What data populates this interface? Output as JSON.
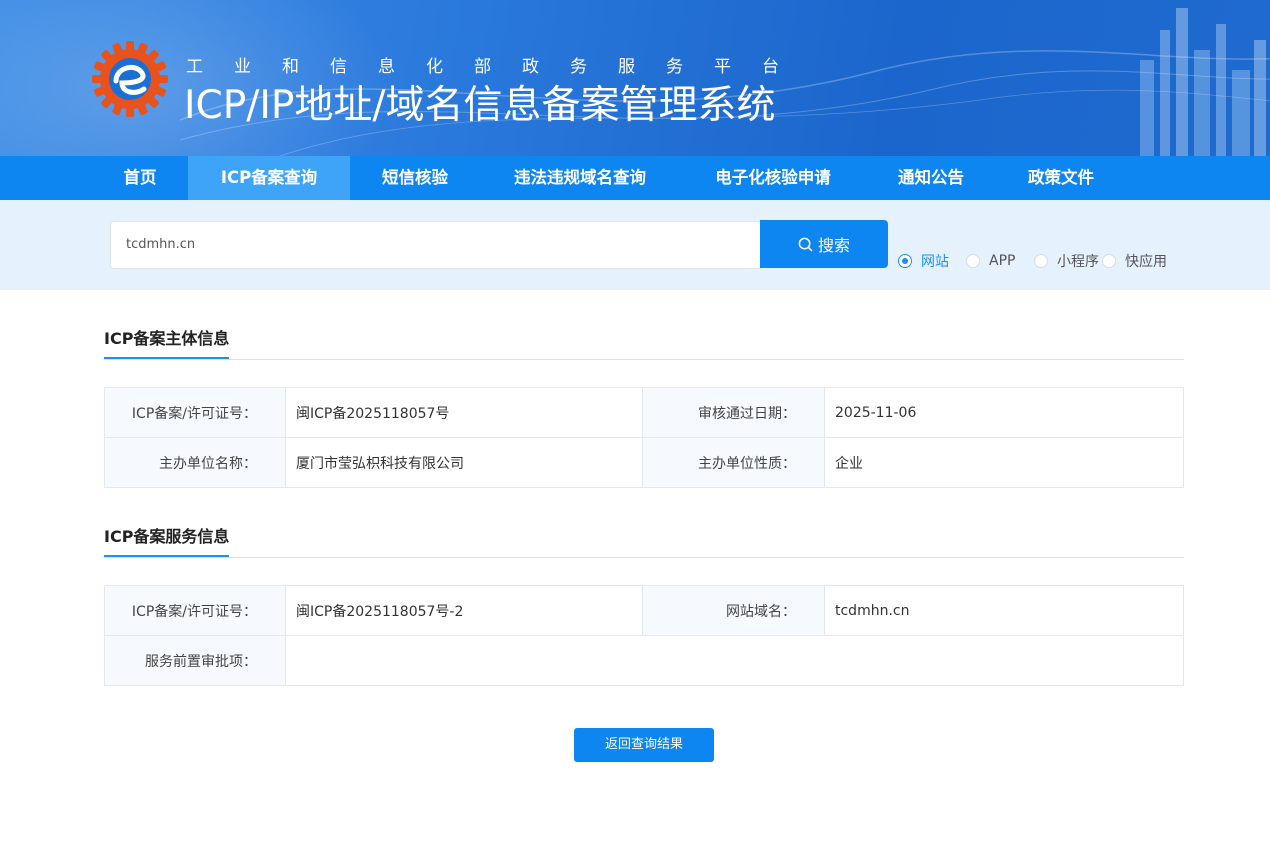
{
  "header": {
    "subtitle": "工业和信息化部政务服务平台",
    "title": "ICP/IP地址/域名信息备案管理系统"
  },
  "nav": {
    "items": [
      {
        "label": "首页"
      },
      {
        "label": "ICP备案查询"
      },
      {
        "label": "短信核验"
      },
      {
        "label": "违法违规域名查询"
      },
      {
        "label": "电子化核验申请"
      },
      {
        "label": "通知公告"
      },
      {
        "label": "政策文件"
      }
    ],
    "active_index": 1
  },
  "search": {
    "value": "tcdmhn.cn",
    "button_label": "搜索",
    "button_icon": "search-icon",
    "options": [
      {
        "label": "网站",
        "checked": true
      },
      {
        "label": "APP",
        "checked": false
      },
      {
        "label": "小程序",
        "checked": false
      },
      {
        "label": "快应用",
        "checked": false
      }
    ]
  },
  "subject_info": {
    "heading": "ICP备案主体信息",
    "rows": [
      {
        "l1": "ICP备案/许可证号：",
        "v1": "闽ICP备2025118057号",
        "l2": "审核通过日期：",
        "v2": "2025-11-06"
      },
      {
        "l1": "主办单位名称：",
        "v1": "厦门市莹弘枳科技有限公司",
        "l2": "主办单位性质：",
        "v2": "企业"
      }
    ]
  },
  "service_info": {
    "heading": "ICP备案服务信息",
    "license_label": "ICP备案/许可证号：",
    "license_value": "闽ICP备2025118057号-2",
    "domain_label": "网站域名：",
    "domain_value": "tcdmhn.cn",
    "approval_label": "服务前置审批项：",
    "approval_value": ""
  },
  "back_button_label": "返回查询结果",
  "colors": {
    "primary": "#0e86f2",
    "nav_active": "#3ea4f8",
    "search_bg": "#e5f1fd",
    "accent_blue": "#1890ff"
  }
}
